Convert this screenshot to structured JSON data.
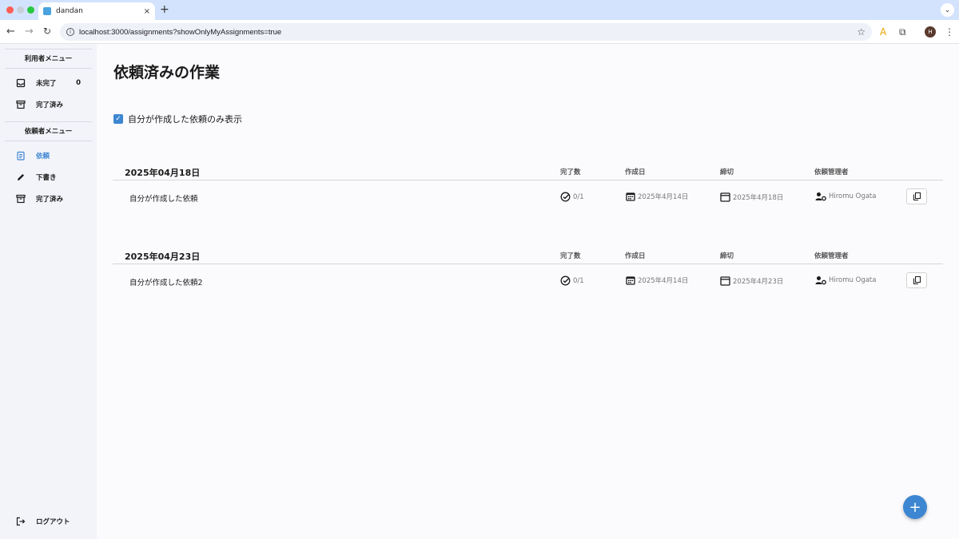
{
  "browser": {
    "tab_title": "dandan",
    "tab_close": "×",
    "new_tab": "+",
    "url": "localhost:3000/assignments?showOnlyMyAssignments=true",
    "profile_initial": "H"
  },
  "sidebar": {
    "user_menu_header": "利用者メニュー",
    "user_items": [
      {
        "label": "未完了",
        "count": "0",
        "icon": "inbox-icon"
      },
      {
        "label": "完了済み",
        "icon": "archive-icon"
      }
    ],
    "requester_menu_header": "依頼者メニュー",
    "requester_items": [
      {
        "label": "依頼",
        "icon": "clipboard-icon",
        "active": true
      },
      {
        "label": "下書き",
        "icon": "pencil-icon"
      },
      {
        "label": "完了済み",
        "icon": "archive-icon"
      }
    ],
    "logout_label": "ログアウト"
  },
  "main": {
    "title": "依頼済みの作業",
    "filter_label": "自分が作成した依頼のみ表示",
    "filter_checked": true,
    "columns": {
      "completed": "完了数",
      "created": "作成日",
      "deadline": "締切",
      "manager": "依頼管理者"
    },
    "groups": [
      {
        "date": "2025年04月18日",
        "rows": [
          {
            "title": "自分が作成した依頼",
            "completed": "0/1",
            "created": "2025年4月14日",
            "deadline": "2025年4月18日",
            "manager": "Hiromu Ogata"
          }
        ]
      },
      {
        "date": "2025年04月23日",
        "rows": [
          {
            "title": "自分が作成した依頼2",
            "completed": "0/1",
            "created": "2025年4月14日",
            "deadline": "2025年4月23日",
            "manager": "Hiromu Ogata"
          }
        ]
      }
    ]
  },
  "colors": {
    "accent": "#3d86d1",
    "sidebar_bg": "#f3f4fa",
    "page_bg": "#fbfbfe"
  }
}
